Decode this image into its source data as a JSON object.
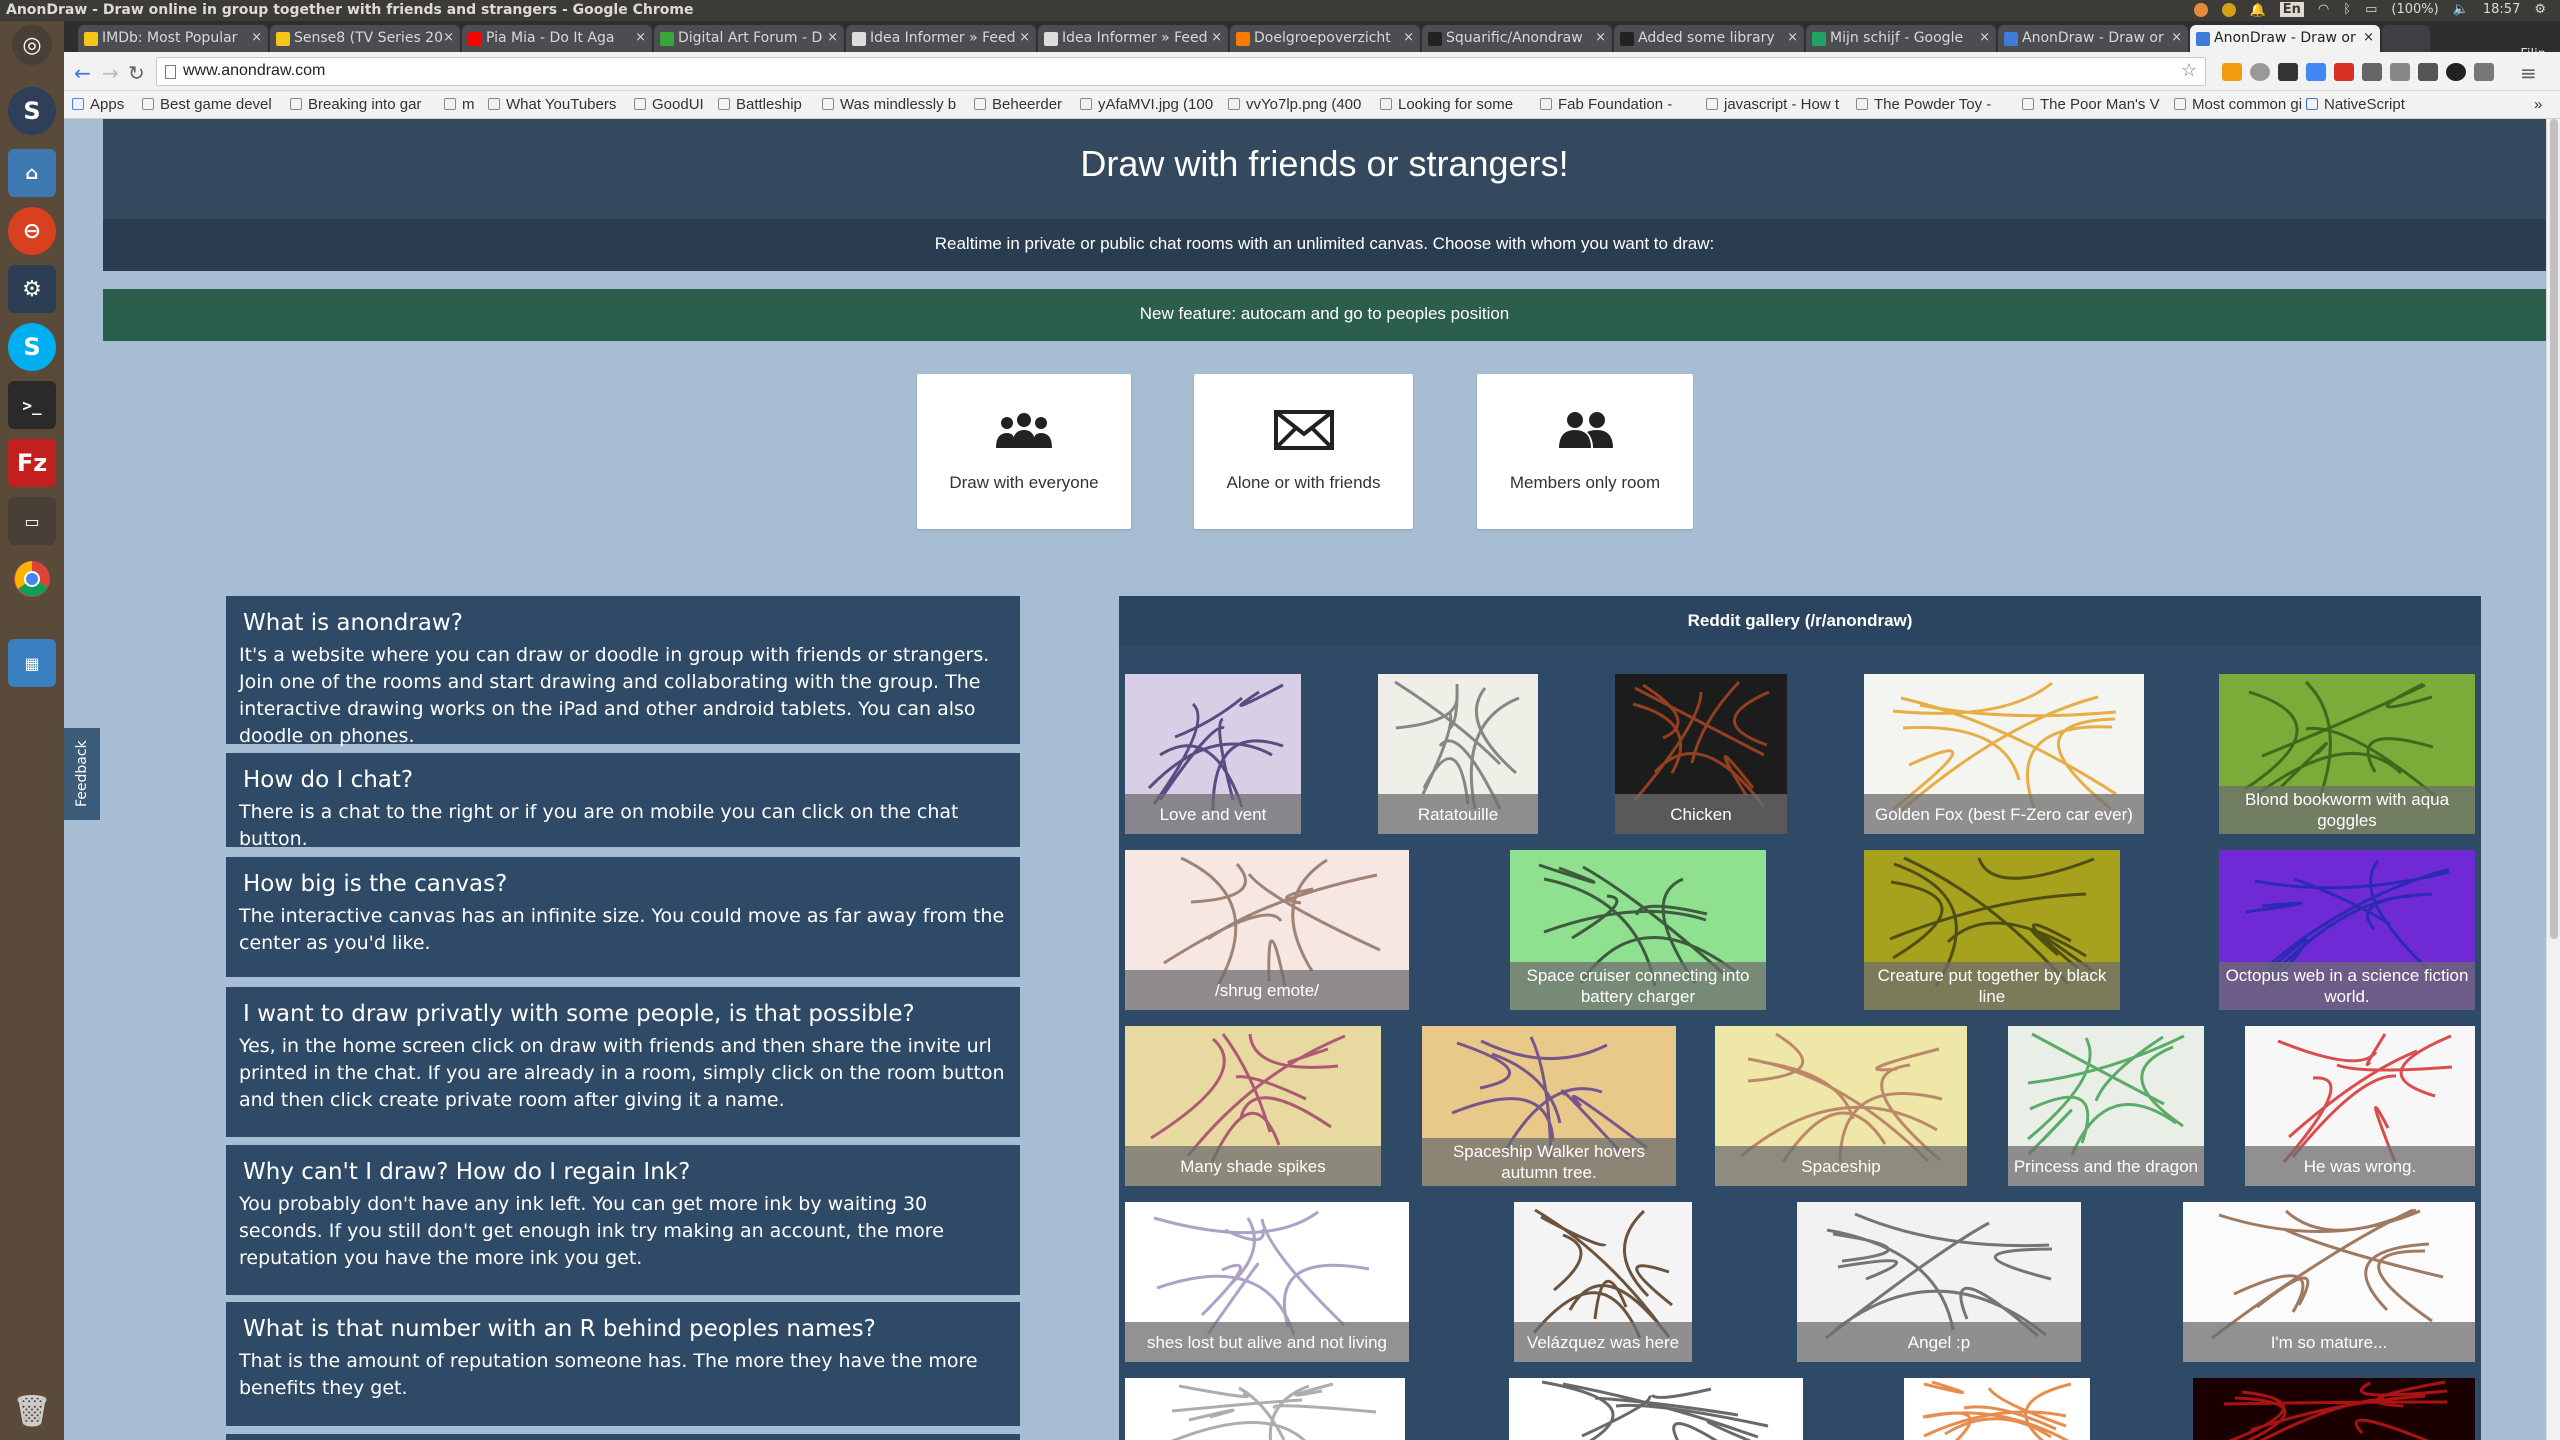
{
  "window": {
    "title": "AnonDraw - Draw online in group together with friends and strangers - Google Chrome",
    "clock": "18:57",
    "battery": "(100%)",
    "keyboard": "En",
    "profile": "Filip"
  },
  "tabs": [
    {
      "label": "IMDb: Most Popular",
      "color": "#f5c518"
    },
    {
      "label": "Sense8 (TV Series 20",
      "color": "#f5c518"
    },
    {
      "label": "Pia Mia - Do It Aga",
      "color": "#ff0000"
    },
    {
      "label": "Digital Art Forum - D",
      "color": "#3aa63a"
    },
    {
      "label": "Idea Informer » Feed",
      "color": "#dddddd"
    },
    {
      "label": "Idea Informer » Feed",
      "color": "#dddddd"
    },
    {
      "label": "Doelgroepoverzicht",
      "color": "#ff7a00"
    },
    {
      "label": "Squarific/Anondraw",
      "color": "#222222"
    },
    {
      "label": "Added some library",
      "color": "#222222"
    },
    {
      "label": "Mijn schijf - Google",
      "color": "#1fa463"
    },
    {
      "label": "AnonDraw - Draw or",
      "color": "#3b7dd8"
    },
    {
      "label": "AnonDraw - Draw or",
      "color": "#3b7dd8",
      "active": true
    }
  ],
  "omnibox": {
    "url": "www.anondraw.com"
  },
  "bookmarks": [
    "Apps",
    "Best game devel",
    "Breaking into gar",
    "m",
    "What YouTubers",
    "GoodUI",
    "Battleship",
    "Was mindlessly b",
    "Beheerder",
    "yAfaMVI.jpg (100",
    "vvYo7lp.png (400",
    "Looking for some",
    "Fab Foundation -",
    "javascript - How t",
    "The Powder Toy -",
    "The Poor Man's V",
    "Most common gi",
    "NativeScript"
  ],
  "page": {
    "hero_title": "Draw with friends or strangers!",
    "subtitle": "Realtime in private or public chat rooms with an unlimited canvas. Choose with whom you want to draw:",
    "feature": "New feature: autocam and go to peoples position",
    "feedback": "Feedback"
  },
  "choices": [
    {
      "label": "Draw with everyone",
      "icon": "group-icon"
    },
    {
      "label": "Alone or with friends",
      "icon": "envelope-icon"
    },
    {
      "label": "Members only room",
      "icon": "users-icon"
    }
  ],
  "faq": [
    {
      "q": "What is anondraw?",
      "a": "It's a website where you can draw or doodle in group with friends or strangers. Join one of the rooms and start drawing and collaborating with the group. The interactive drawing works on the iPad and other android tablets. You can also doodle on phones."
    },
    {
      "q": "How do I chat?",
      "a": "There is a chat to the right or if you are on mobile you can click on the chat button."
    },
    {
      "q": "How big is the canvas?",
      "a": "The interactive canvas has an infinite size. You could move as far away from the center as you'd like."
    },
    {
      "q": "I want to draw privatly with some people, is that possible?",
      "a": "Yes, in the home screen click on draw with friends and then share the invite url printed in the chat. If you are already in a room, simply click on the room button and then click create private room after giving it a name."
    },
    {
      "q": "Why can't I draw? How do I regain Ink?",
      "a": "You probably don't have any ink left. You can get more ink by waiting 30 seconds. If you still don't get enough ink try making an account, the more reputation you have the more ink you get."
    },
    {
      "q": "What is that number with an R behind peoples names?",
      "a": "That is the amount of reputation someone has. The more they have the more benefits they get."
    }
  ],
  "gallery": {
    "title": "Reddit gallery (/r/anondraw)",
    "items": [
      {
        "caption": "Love and vent",
        "bg": "#d8cfe6",
        "accent": "#3a2a6a"
      },
      {
        "caption": "Ratatouille",
        "bg": "#efefe8",
        "accent": "#6b6b6b"
      },
      {
        "caption": "Chicken",
        "bg": "#1c1c1c",
        "accent": "#b04a20"
      },
      {
        "caption": "Golden Fox (best F-Zero car ever)",
        "bg": "#f4f4f0",
        "accent": "#e39c1c"
      },
      {
        "caption": "Blond bookworm with aqua goggles",
        "bg": "#7cab3a",
        "accent": "#2e5a14"
      },
      {
        "caption": "/shrug emote/",
        "bg": "#f6e7e2",
        "accent": "#8a6a5a"
      },
      {
        "caption": "Space cruiser connecting into battery charger",
        "bg": "#8fe08f",
        "accent": "#2a3a2a"
      },
      {
        "caption": "Creature put together by black line",
        "bg": "#a6a21e",
        "accent": "#3a3a10"
      },
      {
        "caption": "Octopus web in a science fiction world.",
        "bg": "#6f2ad6",
        "accent": "#1a2aaa"
      },
      {
        "caption": "Many shade spikes",
        "bg": "#e8d9a0",
        "accent": "#a03a6a"
      },
      {
        "caption": "Spaceship Walker hovers autumn tree.",
        "bg": "#e8c98a",
        "accent": "#5a3a8a"
      },
      {
        "caption": "Spaceship",
        "bg": "#eee7a8",
        "accent": "#b0705a"
      },
      {
        "caption": "Princess and the dragon",
        "bg": "#e9efe6",
        "accent": "#3a9a4a"
      },
      {
        "caption": "He was wrong.",
        "bg": "#f7f7f7",
        "accent": "#d42020"
      },
      {
        "caption": "shes lost but alive and not living",
        "bg": "#ffffff",
        "accent": "#9a8ab8"
      },
      {
        "caption": "Velázquez was here",
        "bg": "#f4f4f4",
        "accent": "#4a2a10"
      },
      {
        "caption": "Angel :p",
        "bg": "#f2f2f2",
        "accent": "#555555"
      },
      {
        "caption": "I'm so mature...",
        "bg": "#fbfbfb",
        "accent": "#8a5a3a"
      },
      {
        "caption": "",
        "bg": "#ffffff",
        "accent": "#999999"
      },
      {
        "caption": "",
        "bg": "#ffffff",
        "accent": "#444444"
      },
      {
        "caption": "",
        "bg": "#ffffff",
        "accent": "#e07020"
      },
      {
        "caption": "",
        "bg": "#1a0000",
        "accent": "#d01818"
      }
    ]
  }
}
